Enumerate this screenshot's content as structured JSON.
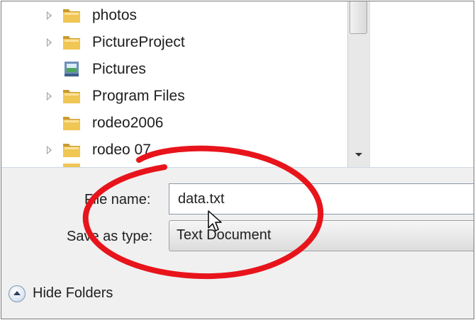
{
  "folder_tree": {
    "items": [
      {
        "label": "photos",
        "icon": "folder-icon",
        "expandable": true
      },
      {
        "label": "PictureProject",
        "icon": "folder-icon",
        "expandable": true
      },
      {
        "label": "Pictures",
        "icon": "pictures-library-icon",
        "expandable": false
      },
      {
        "label": "Program Files",
        "icon": "folder-icon",
        "expandable": true
      },
      {
        "label": "rodeo2006",
        "icon": "folder-icon",
        "expandable": false
      },
      {
        "label": "rodeo 07",
        "icon": "folder-icon",
        "expandable": true
      }
    ]
  },
  "save_form": {
    "file_name_label": "File name:",
    "file_name_value": "data.txt",
    "save_type_label": "Save as type:",
    "save_type_value": "Text Document"
  },
  "footer": {
    "hide_folders_label": "Hide Folders"
  },
  "colors": {
    "annotation": "#e8141b",
    "form_background": "#f0f0f0",
    "folder_yellow": "#e8b84a"
  }
}
